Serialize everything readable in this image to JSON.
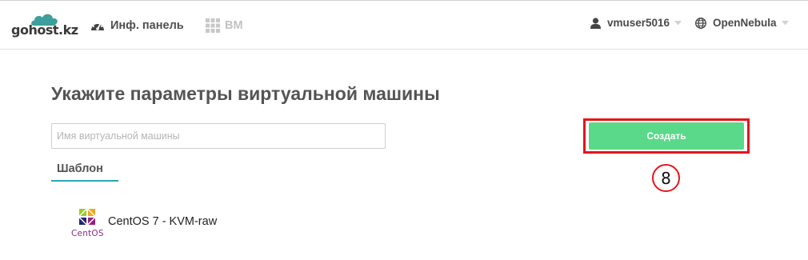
{
  "brand": {
    "name": "gohost.kz",
    "cloud_color": "#3d9f9c"
  },
  "nav": {
    "dashboard_label": "Инф. панель",
    "vms_label": "ВМ"
  },
  "user_menu": {
    "username": "vmuser5016",
    "icon": "user-icon"
  },
  "zone_menu": {
    "zone": "OpenNebula",
    "icon": "globe-icon"
  },
  "page": {
    "title": "Укажите параметры виртуальной машины"
  },
  "form": {
    "vm_name": {
      "value": "",
      "placeholder": "Имя виртуальной машины"
    },
    "create_label": "Создать"
  },
  "annotation": {
    "step": "8",
    "highlight_color": "#e8141b"
  },
  "tabs": [
    {
      "label": "Шаблон",
      "active": true
    }
  ],
  "templates": [
    {
      "name": "CentOS 7 - KVM-raw",
      "logo_text": "CentOS"
    }
  ],
  "colors": {
    "accent_teal": "#2aa8b2",
    "create_green": "#5bd98a"
  }
}
